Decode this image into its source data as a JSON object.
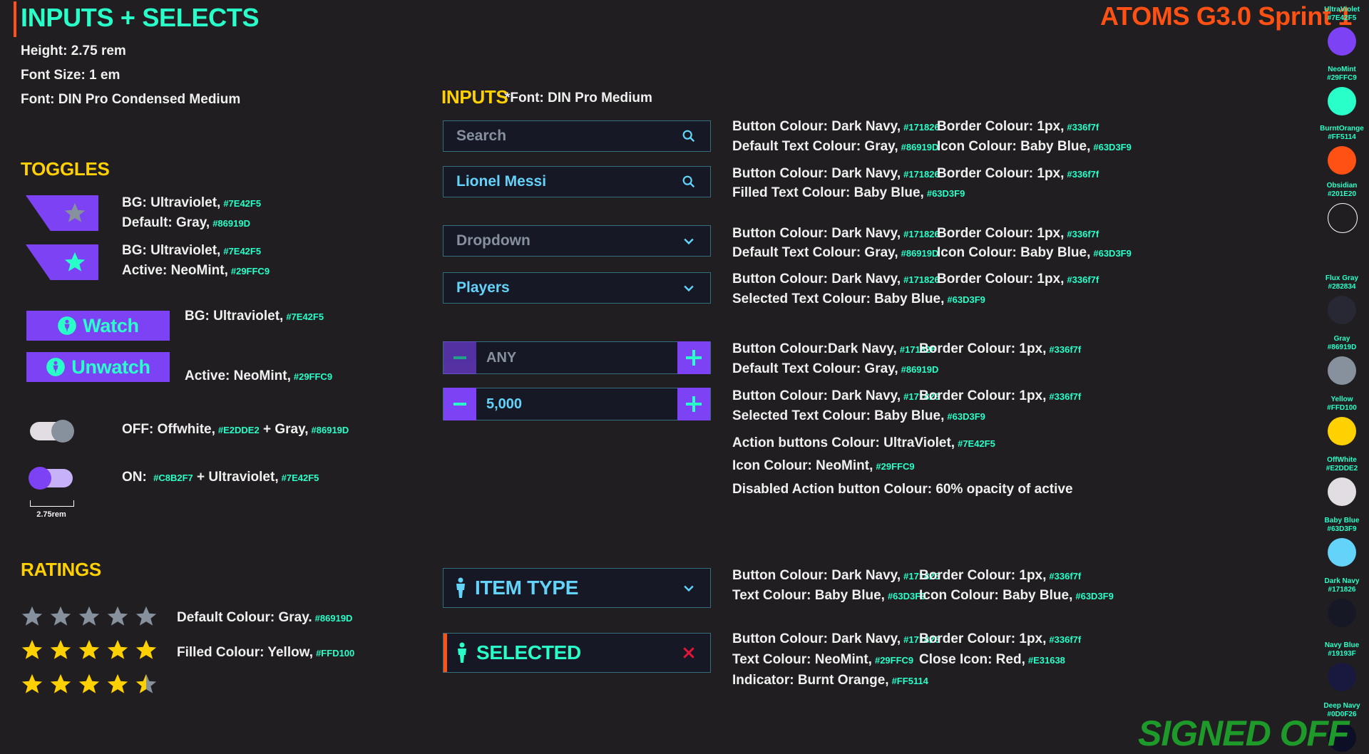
{
  "header": {
    "title": "INPUTS + SELECTS",
    "brand": "ATOMS G3.0 Sprint 1",
    "specs": [
      "Height: 2.75 rem",
      "Font Size: 1 em",
      "Font: DIN Pro Condensed Medium"
    ]
  },
  "toggles": {
    "title": "TOGGLES",
    "star_default": {
      "line1": "BG: Ultraviolet,",
      "line1_hex": "#7E42F5",
      "line2": "Default: Gray,",
      "line2_hex": "#86919D"
    },
    "star_active": {
      "line1": "BG: Ultraviolet,",
      "line1_hex": "#7E42F5",
      "line2": "Active: NeoMint,",
      "line2_hex": "#29FFC9"
    },
    "watch": {
      "label": "Watch",
      "note": "BG: Ultraviolet,",
      "note_hex": "#7E42F5"
    },
    "unwatch": {
      "label": "Unwatch",
      "note": "Active: NeoMint,",
      "note_hex": "#29FFC9"
    },
    "switch_off": {
      "text1": "OFF: Offwhite,",
      "hex1": "#E2DDE2",
      "text2": "+ Gray,",
      "hex2": "#86919D"
    },
    "switch_on": {
      "text1": "ON:",
      "hex1": "#C8B2F7",
      "text2": "+ Ultraviolet,",
      "hex2": "#7E42F5"
    },
    "dimension": "2.75rem"
  },
  "ratings": {
    "title": "RATINGS",
    "default_note": "Default Colour: Gray.",
    "default_hex": "#86919D",
    "filled_note": "Filled Colour: Yellow,",
    "filled_hex": "#FFD100",
    "rows": [
      0,
      5,
      4.5
    ]
  },
  "inputs": {
    "title": "INPUTS",
    "font_note": "*Font: DIN Pro Medium",
    "search_placeholder": "Search",
    "search_filled": "Lionel Messi",
    "dropdown_placeholder": "Dropdown",
    "dropdown_selected": "Players",
    "stepper_default": "ANY",
    "stepper_selected": "5,000",
    "item_type": "ITEM TYPE",
    "selected": "SELECTED"
  },
  "notes": {
    "n1a": "Button Colour: Dark Navy,",
    "n1a_hex": "#171826",
    "n1b": "Border Colour: 1px,",
    "n1b_hex": "#336f7f",
    "n1c": "Default Text Colour: Gray,",
    "n1c_hex": "#86919D",
    "n1d": "Icon Colour: Baby Blue,",
    "n1d_hex": "#63D3F9",
    "n2a": "Button Colour: Dark Navy,",
    "n2a_hex": "#171826",
    "n2b": "Border Colour: 1px,",
    "n2b_hex": "#336f7f",
    "n2c": "Filled Text Colour: Baby Blue,",
    "n2c_hex": "#63D3F9",
    "n3a": "Button Colour: Dark Navy,",
    "n3a_hex": "#171826",
    "n3b": "Border Colour: 1px,",
    "n3b_hex": "#336f7f",
    "n3c": "Default Text Colour: Gray,",
    "n3c_hex": "#86919D",
    "n3d": "Icon Colour: Baby Blue,",
    "n3d_hex": "#63D3F9",
    "n4a": "Button Colour: Dark Navy,",
    "n4a_hex": "#171826",
    "n4b": "Border Colour: 1px,",
    "n4b_hex": "#336f7f",
    "n4c": "Selected Text Colour: Baby Blue,",
    "n4c_hex": "#63D3F9",
    "n5a": "Button Colour:Dark Navy,",
    "n5a_hex": "#171826",
    "n5b": "Border Colour: 1px,",
    "n5b_hex": "#336f7f",
    "n5c": "Default Text Colour: Gray,",
    "n5c_hex": "#86919D",
    "n6a": "Button Colour: Dark Navy,",
    "n6a_hex": "#171826",
    "n6b": "Border Colour: 1px,",
    "n6b_hex": "#336f7f",
    "n6c": "Selected Text Colour: Baby Blue,",
    "n6c_hex": "#63D3F9",
    "n7": "Action buttons Colour: UltraViolet,",
    "n7_hex": "#7E42F5",
    "n8": "Icon Colour: NeoMint,",
    "n8_hex": "#29FFC9",
    "n9": "Disabled Action button Colour: 60% opacity of active",
    "n10a": "Button Colour: Dark Navy,",
    "n10a_hex": "#171826",
    "n10b": "Border Colour: 1px,",
    "n10b_hex": "#336f7f",
    "n10c": "Text Colour: Baby Blue,",
    "n10c_hex": "#63D3F9",
    "n10d": "Icon Colour: Baby Blue,",
    "n10d_hex": "#63D3F9",
    "n11a": "Button Colour: Dark Navy,",
    "n11a_hex": "#171826",
    "n11b": "Border Colour: 1px,",
    "n11b_hex": "#336f7f",
    "n11c": "Text Colour: NeoMint,",
    "n11c_hex": "#29FFC9",
    "n11d": "Close Icon: Red,",
    "n11d_hex": "#E31638",
    "n11e": "Indicator: Burnt Orange,",
    "n11e_hex": "#FF5114"
  },
  "palette": [
    {
      "name": "UltraViolet",
      "hex": "#7E42F5"
    },
    {
      "name": "NeoMint",
      "hex": "#29FFC9"
    },
    {
      "name": "BurntOrange",
      "hex": "#FF5114"
    },
    {
      "name": "Obsidian",
      "hex": "#201E20"
    },
    {
      "name": "Flux Gray",
      "hex": "#282834"
    },
    {
      "name": "Gray",
      "hex": "#86919D"
    },
    {
      "name": "Yellow",
      "hex": "#FFD100"
    },
    {
      "name": "OffWhite",
      "hex": "#E2DDE2"
    },
    {
      "name": "Baby Blue",
      "hex": "#63D3F9"
    },
    {
      "name": "Dark Navy",
      "hex": "#171826"
    },
    {
      "name": "Navy Blue",
      "hex": "#19193F"
    },
    {
      "name": "Deep Navy",
      "hex": "#0D0F26"
    }
  ],
  "signed_off": "SIGNED OFF"
}
